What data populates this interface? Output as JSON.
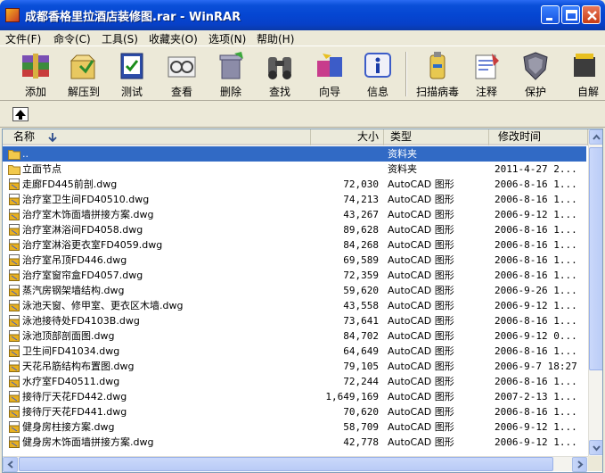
{
  "window": {
    "title": "成都香格里拉酒店装修图.rar - WinRAR",
    "controls": [
      "minimize",
      "maximize",
      "close"
    ]
  },
  "menu": [
    "文件(F)",
    "命令(C)",
    "工具(S)",
    "收藏夹(O)",
    "选项(N)",
    "帮助(H)"
  ],
  "toolbar": [
    {
      "label": "添加",
      "icon": "add-archive-icon"
    },
    {
      "label": "解压到",
      "icon": "extract-to-icon"
    },
    {
      "label": "测试",
      "icon": "test-icon"
    },
    {
      "label": "查看",
      "icon": "view-icon"
    },
    {
      "label": "删除",
      "icon": "delete-icon"
    },
    {
      "label": "查找",
      "icon": "find-icon"
    },
    {
      "label": "向导",
      "icon": "wizard-icon"
    },
    {
      "label": "信息",
      "icon": "info-icon"
    },
    {
      "label": "扫描病毒",
      "icon": "virus-scan-icon"
    },
    {
      "label": "注释",
      "icon": "comment-icon"
    },
    {
      "label": "保护",
      "icon": "protect-icon"
    },
    {
      "label": "自解",
      "icon": "sfx-icon"
    }
  ],
  "columns": {
    "name": "名称",
    "size": "大小",
    "type": "类型",
    "modified": "修改时间"
  },
  "files": [
    {
      "name": "..",
      "size": "",
      "type": "资料夹",
      "modified": "",
      "kind": "folder",
      "selected": true
    },
    {
      "name": "立面节点",
      "size": "",
      "type": "资料夹",
      "modified": "2011-4-27 2...",
      "kind": "folder"
    },
    {
      "name": "走廊FD445前剖.dwg",
      "size": "72,030",
      "type": "AutoCAD 图形",
      "modified": "2006-8-16 1...",
      "kind": "dwg"
    },
    {
      "name": "治疗室卫生间FD40510.dwg",
      "size": "74,213",
      "type": "AutoCAD 图形",
      "modified": "2006-8-16 1...",
      "kind": "dwg"
    },
    {
      "name": "治疗室木饰面墙拼接方案.dwg",
      "size": "43,267",
      "type": "AutoCAD 图形",
      "modified": "2006-9-12 1...",
      "kind": "dwg"
    },
    {
      "name": "治疗室淋浴间FD4058.dwg",
      "size": "89,628",
      "type": "AutoCAD 图形",
      "modified": "2006-8-16 1...",
      "kind": "dwg"
    },
    {
      "name": "治疗室淋浴更衣室FD4059.dwg",
      "size": "84,268",
      "type": "AutoCAD 图形",
      "modified": "2006-8-16 1...",
      "kind": "dwg"
    },
    {
      "name": "治疗室吊顶FD446.dwg",
      "size": "69,589",
      "type": "AutoCAD 图形",
      "modified": "2006-8-16 1...",
      "kind": "dwg"
    },
    {
      "name": "治疗室窗帘盒FD4057.dwg",
      "size": "72,359",
      "type": "AutoCAD 图形",
      "modified": "2006-8-16 1...",
      "kind": "dwg"
    },
    {
      "name": "蒸汽房钢架墙结构.dwg",
      "size": "59,620",
      "type": "AutoCAD 图形",
      "modified": "2006-9-26 1...",
      "kind": "dwg"
    },
    {
      "name": "泳池天窗、修甲室、更衣区木墙.dwg",
      "size": "43,558",
      "type": "AutoCAD 图形",
      "modified": "2006-9-12 1...",
      "kind": "dwg"
    },
    {
      "name": "泳池接待处FD4103B.dwg",
      "size": "73,641",
      "type": "AutoCAD 图形",
      "modified": "2006-8-16 1...",
      "kind": "dwg"
    },
    {
      "name": "泳池顶部剖面图.dwg",
      "size": "84,702",
      "type": "AutoCAD 图形",
      "modified": "2006-9-12 0...",
      "kind": "dwg"
    },
    {
      "name": "卫生间FD41034.dwg",
      "size": "64,649",
      "type": "AutoCAD 图形",
      "modified": "2006-8-16 1...",
      "kind": "dwg"
    },
    {
      "name": "天花吊筋结构布置图.dwg",
      "size": "79,105",
      "type": "AutoCAD 图形",
      "modified": "2006-9-7 18:27",
      "kind": "dwg"
    },
    {
      "name": "水疗室FD40511.dwg",
      "size": "72,244",
      "type": "AutoCAD 图形",
      "modified": "2006-8-16 1...",
      "kind": "dwg"
    },
    {
      "name": "接待厅天花FD442.dwg",
      "size": "1,649,169",
      "type": "AutoCAD 图形",
      "modified": "2007-2-13 1...",
      "kind": "dwg"
    },
    {
      "name": "接待厅天花FD441.dwg",
      "size": "70,620",
      "type": "AutoCAD 图形",
      "modified": "2006-8-16 1...",
      "kind": "dwg"
    },
    {
      "name": "健身房柱接方案.dwg",
      "size": "58,709",
      "type": "AutoCAD 图形",
      "modified": "2006-9-12 1...",
      "kind": "dwg"
    },
    {
      "name": "健身房木饰面墙拼接方案.dwg",
      "size": "42,778",
      "type": "AutoCAD 图形",
      "modified": "2006-9-12 1...",
      "kind": "dwg"
    }
  ],
  "colors": {
    "titlebar": "#0546d2",
    "selection": "#316ac5",
    "folder": "#f2c94c",
    "dwg": "#e8b020"
  }
}
